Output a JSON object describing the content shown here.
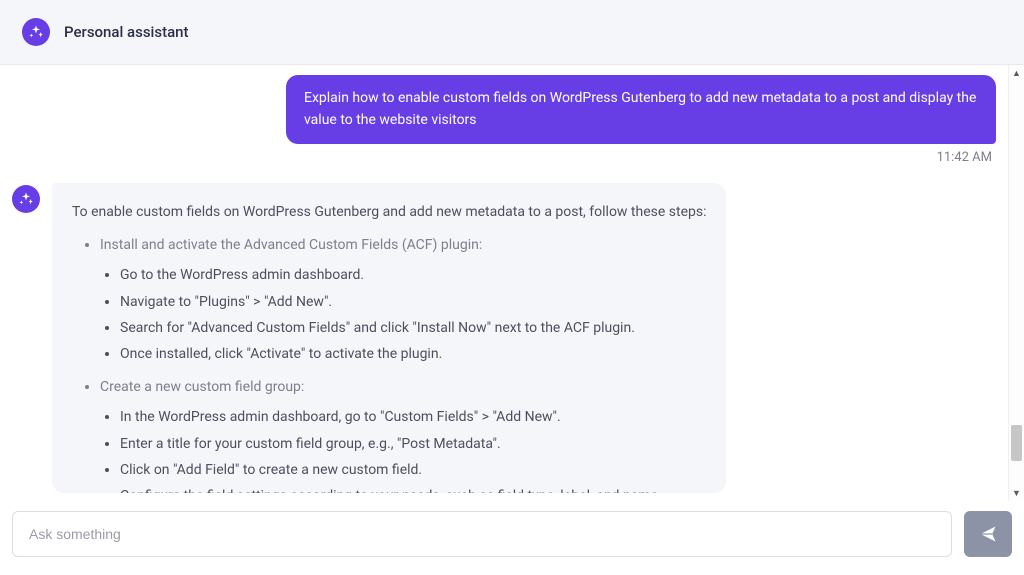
{
  "header": {
    "title": "Personal assistant"
  },
  "user_message": {
    "text": "Explain how to enable custom fields on WordPress Gutenberg to add new metadata to a post and display the value to the website visitors",
    "timestamp": "11:42 AM"
  },
  "assistant_message": {
    "intro": "To enable custom fields on WordPress Gutenberg and add new metadata to a post, follow these steps:",
    "steps": [
      {
        "title": "Install and activate the Advanced Custom Fields (ACF) plugin:",
        "items": [
          "Go to the WordPress admin dashboard.",
          "Navigate to \"Plugins\" > \"Add New\".",
          "Search for \"Advanced Custom Fields\" and click \"Install Now\" next to the ACF plugin.",
          "Once installed, click \"Activate\" to activate the plugin."
        ]
      },
      {
        "title": "Create a new custom field group:",
        "items": [
          "In the WordPress admin dashboard, go to \"Custom Fields\" > \"Add New\".",
          "Enter a title for your custom field group, e.g., \"Post Metadata\".",
          "Click on \"Add Field\" to create a new custom field.",
          "Configure the field settings according to your needs, such as field type, label, and name."
        ]
      }
    ]
  },
  "composer": {
    "placeholder": "Ask something"
  }
}
